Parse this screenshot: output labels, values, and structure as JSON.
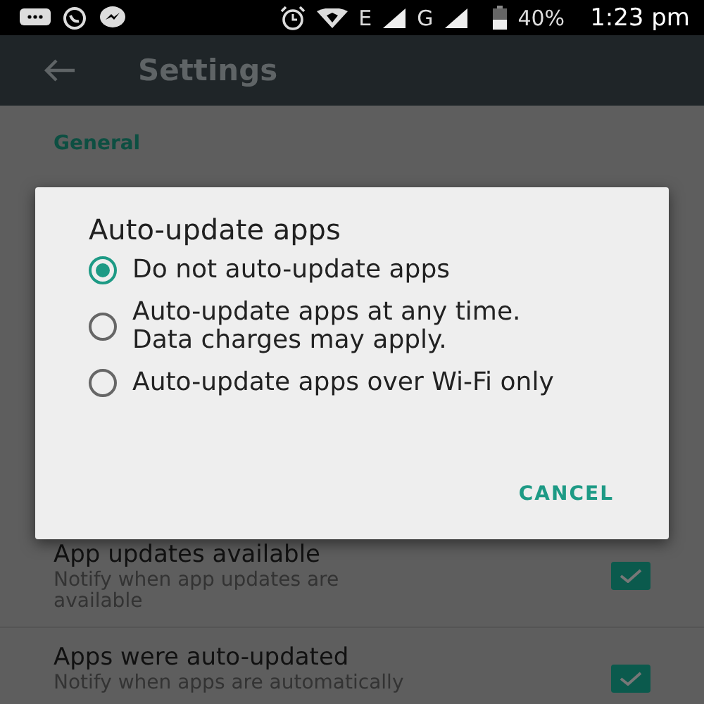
{
  "status_bar": {
    "network_1": "E",
    "network_2": "G",
    "battery": "40%",
    "time": "1:23 pm"
  },
  "app_bar": {
    "title": "Settings"
  },
  "section": "General",
  "settings": [
    {
      "title": "App updates available",
      "subtitle": "Notify when app updates are available",
      "checked": true
    },
    {
      "title": "Apps were auto-updated",
      "subtitle": "Notify when apps are automatically",
      "checked": true
    }
  ],
  "dialog": {
    "title": "Auto-update apps",
    "options": [
      {
        "label": "Do not auto-update apps",
        "selected": true
      },
      {
        "label": "Auto-update apps at any time. Data charges may apply.",
        "selected": false
      },
      {
        "label": "Auto-update apps over Wi-Fi only",
        "selected": false
      }
    ],
    "buttons": [
      "CANCEL"
    ]
  }
}
